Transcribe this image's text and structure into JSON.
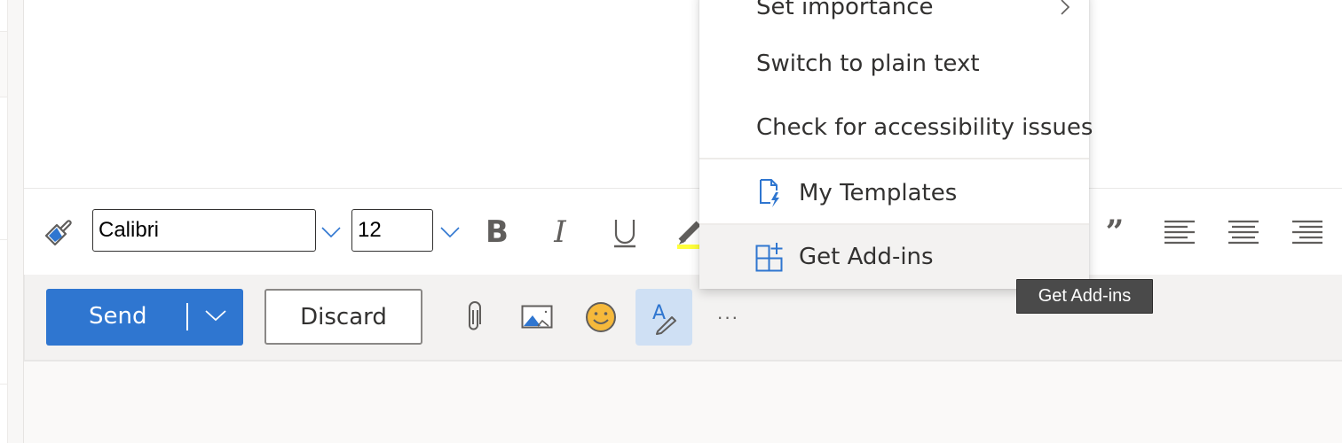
{
  "format_toolbar": {
    "format_painter": "format-painter-icon",
    "font_name": "Calibri",
    "font_size": "12",
    "bold": "B",
    "italic": "I",
    "underline": "U",
    "quote": "”",
    "highlight_color": "#ffff3b"
  },
  "action_bar": {
    "send_label": "Send",
    "discard_label": "Discard",
    "more_label": "···",
    "accent_color": "#2f76d0"
  },
  "menu": {
    "items": [
      {
        "label": "Set importance",
        "has_submenu": true
      },
      {
        "label": "Switch to plain text"
      },
      {
        "label": "Check for accessibility issues"
      },
      {
        "label": "My Templates",
        "icon": "templates-icon"
      },
      {
        "label": "Get Add-ins",
        "icon": "add-ins-icon",
        "hovered": true
      }
    ]
  },
  "tooltip": {
    "text": "Get Add-ins"
  }
}
